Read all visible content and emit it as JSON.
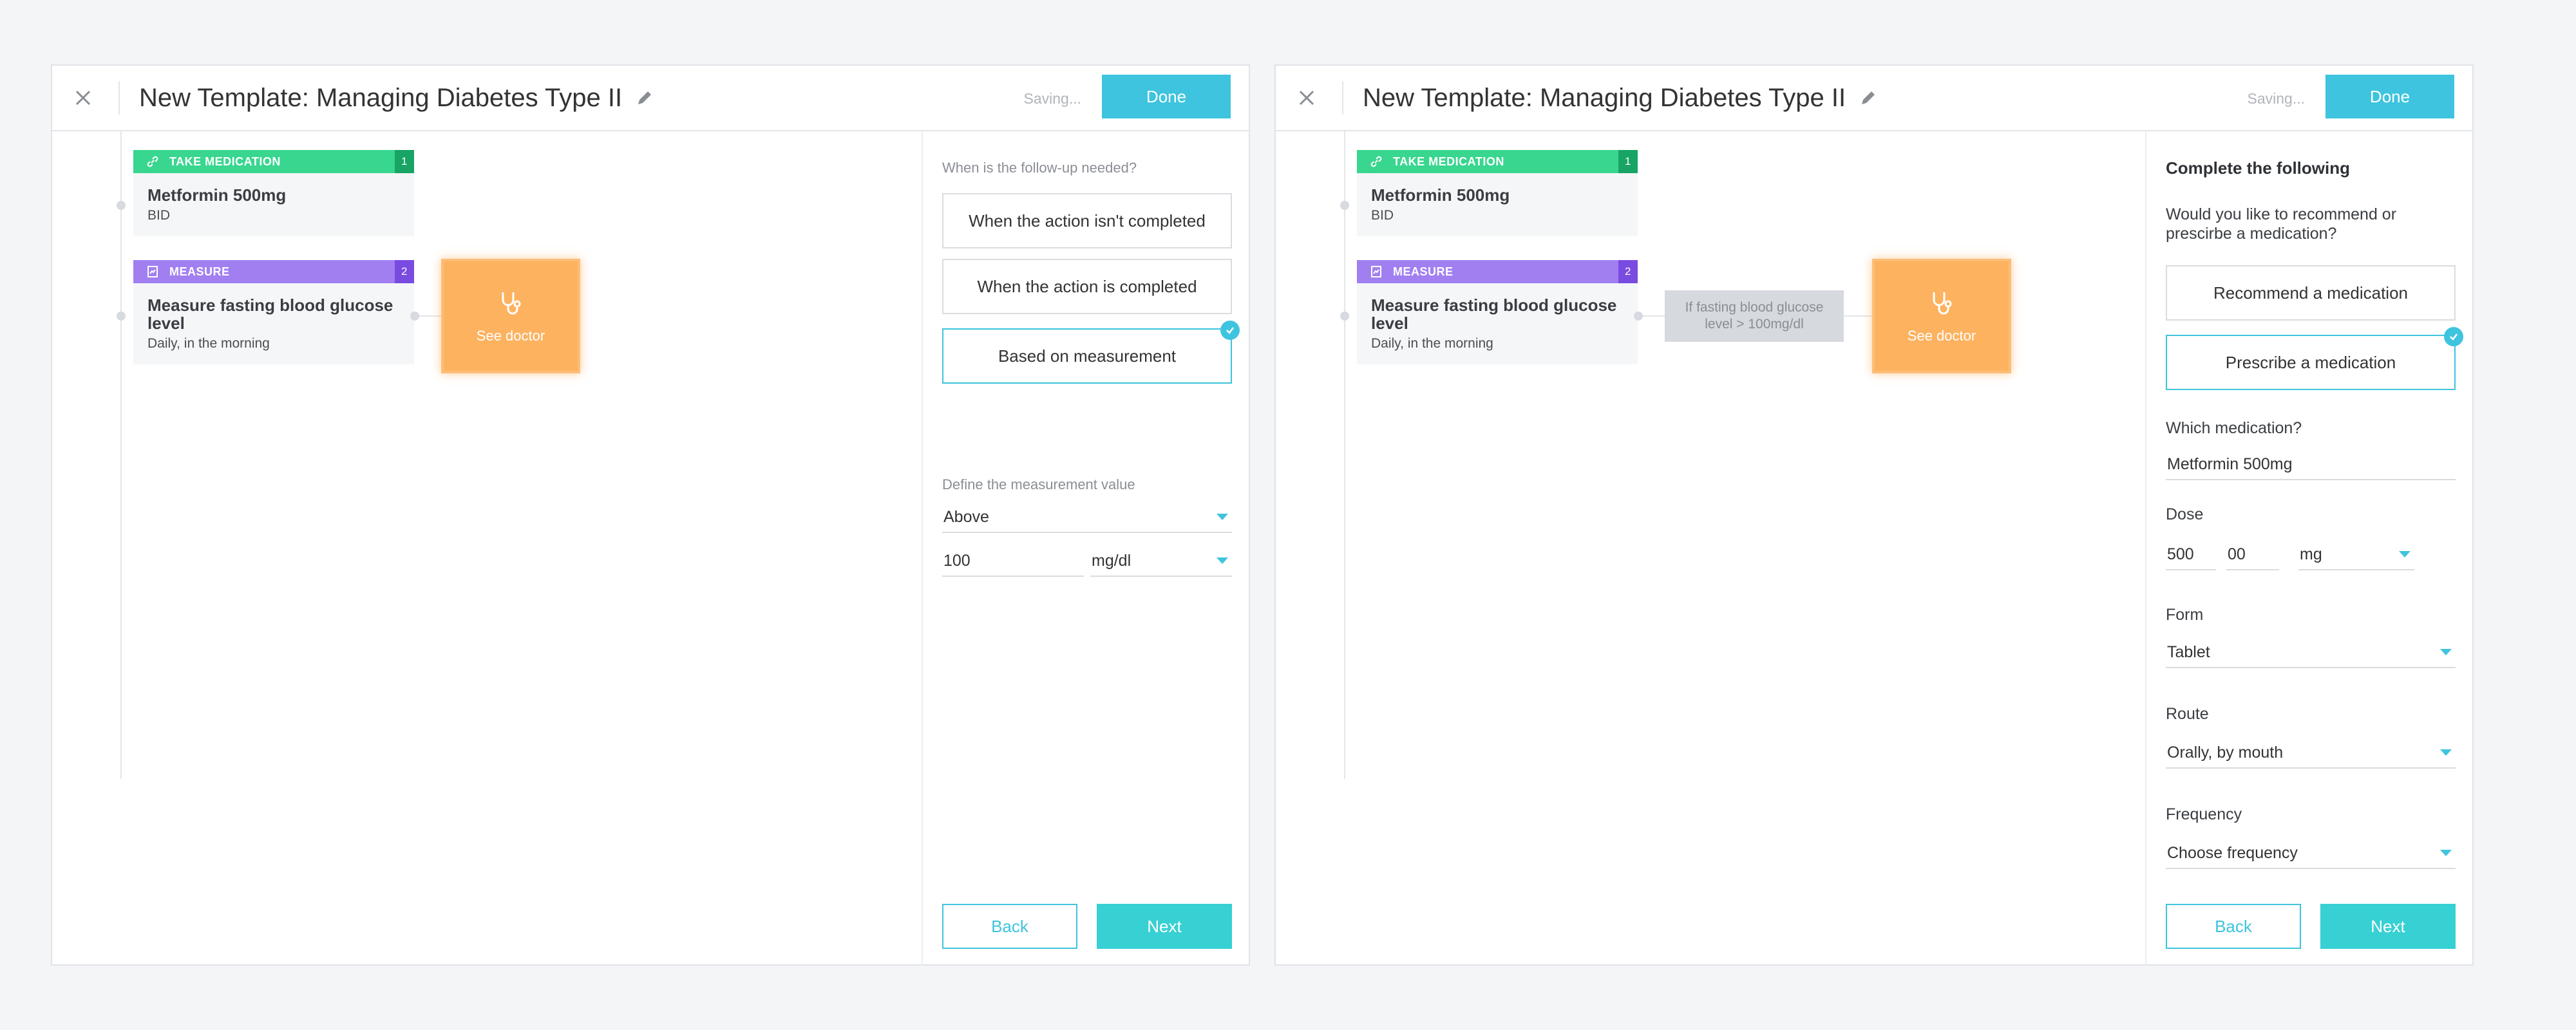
{
  "colors": {
    "accent": "#3ec4de",
    "take_medication": "#38d68f",
    "measure": "#a17ff1",
    "see_doctor": "#fdb25f"
  },
  "windows": [
    {
      "title": "New Template: Managing Diabetes Type II",
      "saving": "Saving...",
      "done": "Done",
      "cards": [
        {
          "type": "TAKE MEDICATION",
          "num": "1",
          "title": "Metformin 500mg",
          "sub": "BID",
          "icon": "link-icon"
        },
        {
          "type": "MEASURE",
          "num": "2",
          "title": "Measure fasting blood glucose level",
          "sub": "Daily, in the morning",
          "icon": "chart-icon"
        }
      ],
      "doctor_label": "See doctor",
      "panel": {
        "question": "When is the follow-up needed?",
        "options": [
          "When the action isn't completed",
          "When the action is completed",
          "Based on measurement"
        ],
        "selected_option": "Based on measurement",
        "define_label": "Define the measurement value",
        "comparator": "Above",
        "value": "100",
        "unit": "mg/dl",
        "back": "Back",
        "next": "Next"
      }
    },
    {
      "title": "New Template: Managing Diabetes Type II",
      "saving": "Saving...",
      "done": "Done",
      "cards": [
        {
          "type": "TAKE MEDICATION",
          "num": "1",
          "title": "Metformin 500mg",
          "sub": "BID",
          "icon": "link-icon"
        },
        {
          "type": "MEASURE",
          "num": "2",
          "title": "Measure fasting blood glucose level",
          "sub": "Daily, in the morning",
          "icon": "chart-icon"
        }
      ],
      "condition": "If fasting blood glucose level > 100mg/dl",
      "doctor_label": "See doctor",
      "panel": {
        "heading": "Complete the following",
        "question": "Would you like to recommend or prescirbe a medication?",
        "options": [
          "Recommend a medication",
          "Prescribe a medication"
        ],
        "selected_option": "Prescribe a medication",
        "which_label": "Which medication?",
        "medication": "Metformin 500mg",
        "dose_label": "Dose",
        "dose_whole": "500",
        "dose_decimal": "00",
        "dose_unit": "mg",
        "form_label": "Form",
        "form": "Tablet",
        "route_label": "Route",
        "route": "Orally, by mouth",
        "frequency_label": "Frequency",
        "frequency_placeholder": "Choose frequency",
        "back": "Back",
        "next": "Next"
      }
    }
  ]
}
